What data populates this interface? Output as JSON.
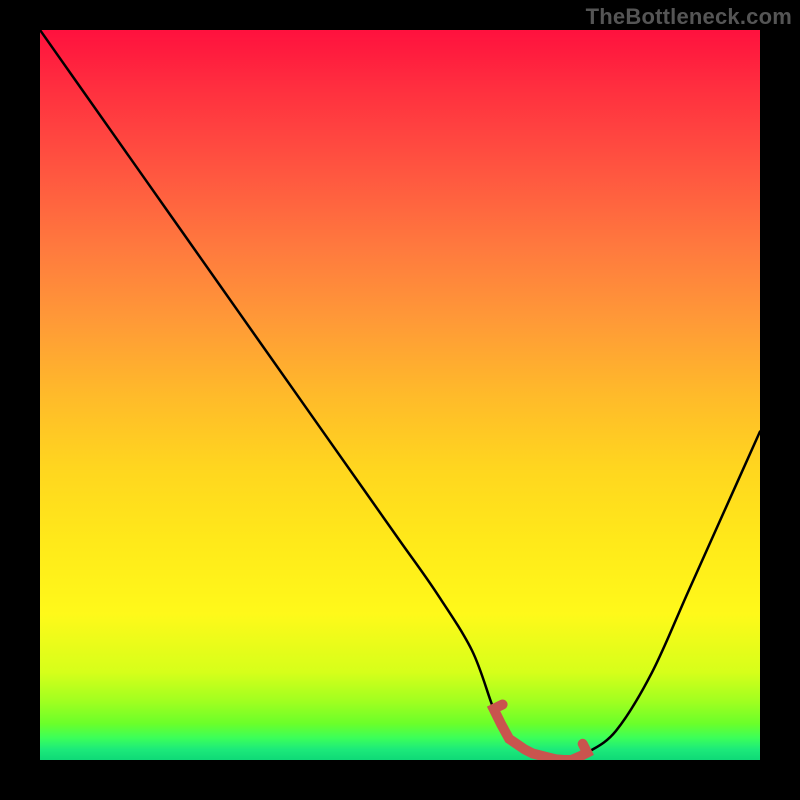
{
  "watermark": "TheBottleneck.com",
  "chart_data": {
    "type": "line",
    "title": "",
    "xlabel": "",
    "ylabel": "",
    "x": [
      0,
      5,
      10,
      15,
      20,
      25,
      30,
      35,
      40,
      45,
      50,
      55,
      60,
      63,
      65,
      68,
      72,
      74,
      76,
      80,
      85,
      90,
      95,
      100
    ],
    "values": [
      100,
      93,
      86,
      79,
      72,
      65,
      58,
      51,
      44,
      37,
      30,
      23,
      15,
      7,
      3,
      1,
      0,
      0,
      1,
      4,
      12,
      23,
      34,
      45
    ],
    "ylim": [
      0,
      100
    ],
    "xlim": [
      0,
      100
    ],
    "optimal_range_x": [
      63,
      76
    ],
    "background": "heat-gradient-red-to-green",
    "series": [
      {
        "name": "bottleneck-curve",
        "values_ref": "values"
      }
    ]
  },
  "colors": {
    "curve": "#000000",
    "marker": "#c9544e",
    "frame": "#000000",
    "watermark": "#555555"
  }
}
